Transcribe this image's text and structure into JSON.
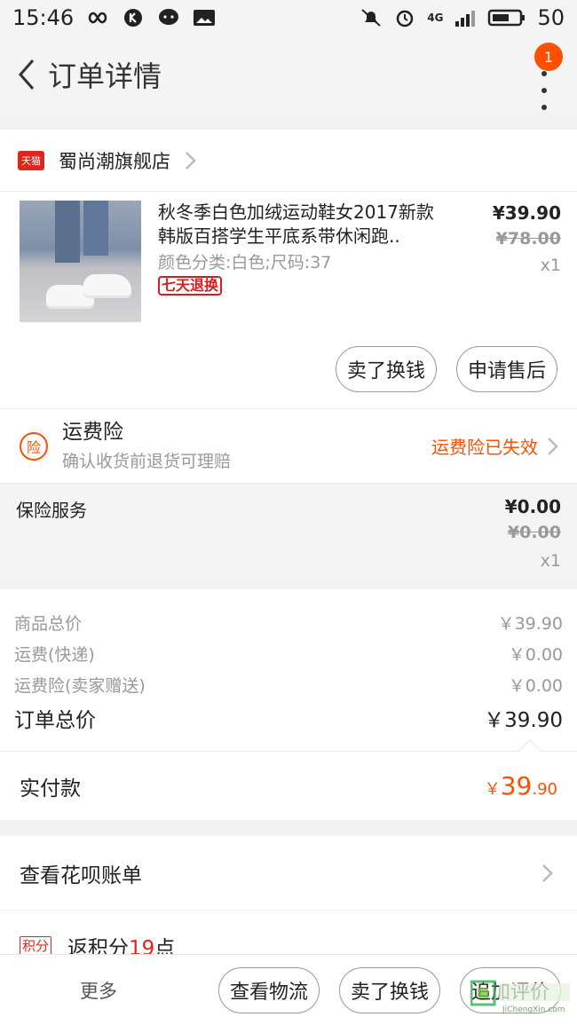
{
  "status_bar": {
    "time": "15:46",
    "network": "4G",
    "battery": "50"
  },
  "nav": {
    "title": "订单详情",
    "badge": "1"
  },
  "shop": {
    "platform_badge": "天猫",
    "name": "蜀尚潮旗舰店"
  },
  "item": {
    "title": "秋冬季白色加绒运动鞋女2017新款韩版百搭学生平底系带休闲跑..",
    "spec": "颜色分类:白色;尺码:37",
    "return_tag": "七天退换",
    "price_now": "¥39.90",
    "price_old": "¥78.00",
    "qty": "x1",
    "btn_sell": "卖了换钱",
    "btn_after_sale": "申请售后"
  },
  "insurance": {
    "icon": "险",
    "title": "运费险",
    "subtitle": "确认收货前退货可理赔",
    "status": "运费险已失效"
  },
  "service": {
    "label": "保险服务",
    "price": "¥0.00",
    "price_old": "¥0.00",
    "qty": "x1"
  },
  "summary": {
    "lines": [
      {
        "label": "商品总价",
        "value": "￥39.90"
      },
      {
        "label": "运费(快递)",
        "value": "￥0.00"
      },
      {
        "label": "运费险(卖家赠送)",
        "value": "￥0.00"
      }
    ],
    "total_label": "订单总价",
    "total_value": "￥39.90"
  },
  "paid": {
    "label": "实付款",
    "currency": "￥",
    "int": "39",
    "dec": ".90"
  },
  "huabei": {
    "label": "查看花呗账单"
  },
  "points": {
    "badge": "积分",
    "prefix": "返积分",
    "num": "19",
    "suffix": "点"
  },
  "bottom": {
    "more": "更多",
    "btn_logistics": "查看物流",
    "btn_sell": "卖了换钱",
    "btn_review": "追加评价"
  },
  "watermark": {
    "text": "JiChengXin.com"
  }
}
